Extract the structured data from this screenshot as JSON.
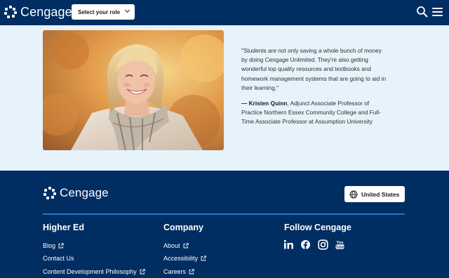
{
  "header": {
    "brand": "Cengage",
    "role_select": "Select your role",
    "search_icon": "search-icon",
    "menu_icon": "hamburger-menu-icon"
  },
  "testimonial": {
    "photo": "smiling-woman-photo",
    "quote": "\"Students are not only saving a whole bunch of money by doing Cengage Unlimited. They're also getting wonderful top quality resources and textbooks and homework management systems that are going to aid in their learning.\"",
    "author": "— Kristen Quinn",
    "author_title": ", Adjunct Associate Professor of Practice Northern Essex Community College and Full-Time Associate Professor at Assumption University"
  },
  "footer": {
    "brand": "Cengage",
    "country": "United States",
    "columns": [
      {
        "title": "Higher Ed",
        "links": [
          "Blog",
          "Contact Us",
          "Content Development Philosophy"
        ]
      },
      {
        "title": "Company",
        "links": [
          "About",
          "Accessibility",
          "Careers"
        ]
      },
      {
        "title": "Follow Cengage",
        "links": []
      }
    ],
    "social_icons": [
      "linkedin-icon",
      "facebook-icon",
      "instagram-icon",
      "youtube-icon"
    ]
  },
  "colors": {
    "navy": "#002d62",
    "band_bg": "#e6f3fb",
    "rule_blue": "#1a7ac4"
  }
}
